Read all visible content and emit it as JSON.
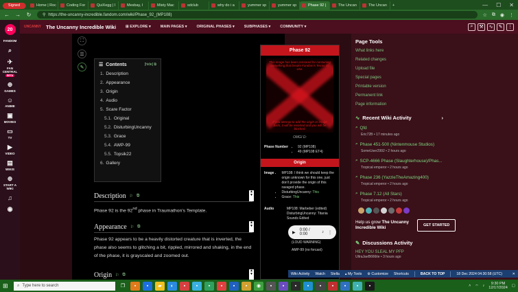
{
  "browser": {
    "tabs": [
      {
        "label": "Home | Roc"
      },
      {
        "label": "Coding For"
      },
      {
        "label": "QuiXegg | I"
      },
      {
        "label": "Mesbay, I"
      },
      {
        "label": "Misty Mac"
      },
      {
        "label": "sdclub"
      },
      {
        "label": "why do i a"
      },
      {
        "label": "yummer sp"
      },
      {
        "label": "yummer sp"
      },
      {
        "label": "Phase 92 |"
      },
      {
        "label": "The Uncan"
      },
      {
        "label": "The Uncan"
      }
    ],
    "signed_in_label": "Signed",
    "url": "https://the-uncanny-incredible.fandom.com/wiki/Phase_92_(MP108)"
  },
  "fandom_rail": {
    "logo_text": "20",
    "items": [
      {
        "label": "FANDOM"
      },
      {
        "label": "FAN CENTRAL"
      },
      {
        "label": "BETA"
      },
      {
        "label": "GAMES"
      },
      {
        "label": "ANIME"
      },
      {
        "label": "MOVIES"
      },
      {
        "label": "TV"
      },
      {
        "label": "VIDEO"
      },
      {
        "label": "WIKIS"
      },
      {
        "label": "START A WIKI"
      }
    ]
  },
  "wiki_header": {
    "logo": "UNCANNY",
    "title": "The Uncanny Incredible Wiki",
    "nav": [
      "EXPLORE",
      "MAIN PAGES",
      "ORIGINAL PHASES",
      "SUBPHASES",
      "COMMUNITY"
    ]
  },
  "toc": {
    "title": "Contents",
    "hide": "hide",
    "items": [
      {
        "num": "1.",
        "label": "Description"
      },
      {
        "num": "2.",
        "label": "Appearance"
      },
      {
        "num": "3.",
        "label": "Origin"
      },
      {
        "num": "4.",
        "label": "Audio"
      },
      {
        "num": "5.",
        "label": "Scare Factor"
      },
      {
        "num": "5.1.",
        "label": "Original"
      },
      {
        "num": "5.2.",
        "label": "DisturbingUncanny"
      },
      {
        "num": "5.3.",
        "label": "Grace"
      },
      {
        "num": "5.4.",
        "label": "AWP-99"
      },
      {
        "num": "5.5.",
        "label": "Topsik22"
      },
      {
        "num": "6.",
        "label": "Gallery"
      }
    ]
  },
  "article": {
    "description_h": "Description",
    "description_pre": "Phase 92 is the 92",
    "description_sup": "nd",
    "description_post": " phase in Traumathon's Template.",
    "appearance_h": "Appearance",
    "appearance_text": "Phase 92 appears to be a heavily distorted creature that is inverted, the phase also seems to glitching a bit, rippled, mirrored and shaking, in the end of the phase, it is grayscaled and zoomed out.",
    "origin_h": "Origin"
  },
  "infobox": {
    "title": "Phase 92",
    "image_caption_top": "This image has been censored for containing something that breaks Fandom's Terms Of Use.",
    "image_caption_bottom": "If you attempt to add the origin or image back, it will be reverted and you will be blocked.",
    "image_caption_below": "OMGI D:",
    "phase_number_k": "Phase Number",
    "phase_number_v1": "92 (MP108)",
    "phase_number_v2": "49 (MP108 ET4)",
    "origin_h": "Origin",
    "image_k": "Image",
    "image_v1": "MP108: I think we should keep the origin unknown for this one, just don't provide the origin of this ravaged phase.",
    "image_v2_pre": "DisturbingUncanny: ",
    "image_v2_link": "This",
    "image_v3_pre": "Grace: ",
    "image_v3_link": "This",
    "audio_k": "Audio",
    "audio_v1": "MP108: Marbeber (edited)",
    "audio_v2": "DisturbingUncanny: Titania Sounds Edited",
    "audio_time": "0:00 / 0:00",
    "audio_note": "(LOUD WARNING)",
    "audio_extra": "AMP-99 (no forcast)"
  },
  "sidebar": {
    "page_tools_h": "Page Tools",
    "page_tools": [
      "What links here",
      "Related changes",
      "Upload file",
      "Special pages",
      "Printable version",
      "Permanent link",
      "Page information"
    ],
    "recent_h": "Recent Wiki Activity",
    "recent": [
      {
        "title": "Qfd",
        "meta": "Eric72B • 17 minutes ago"
      },
      {
        "title": "Phase 451-500 (Nintenmouse Studios)",
        "meta": "SomeUser2992 • 2 hours ago"
      },
      {
        "title": "SCP-4666 Phase (Slaughterhouse)/Phas...",
        "meta": "Tropical emperor • 2 hours ago"
      },
      {
        "title": "Phase 236 (YazzieTheAmazing400)",
        "meta": "Tropical emperor • 2 hours ago"
      },
      {
        "title": "Phase 7.12 (All Stars)",
        "meta": "Tropical emperor • 2 hours ago"
      }
    ],
    "grow_pre": "Help us grow ",
    "grow_bold": "The Uncanny Incredible Wiki",
    "get_started": "GET STARTED",
    "discussions_h": "Discussions Activity",
    "discussions_item": "HEY YOU SLEAL MY PFP",
    "discussions_meta": "UltraJaeB666ite • 3 hours ago"
  },
  "wikibar": {
    "items": [
      "Wiki Activity",
      "Watch",
      "Stella",
      "My Tools",
      "Customize",
      "Shortcuts",
      "BACK TO TOP",
      "18 Dec 2024 04:30:58 (UTC)"
    ]
  },
  "taskbar": {
    "search_placeholder": "Type here to search",
    "time": "9:30 PM",
    "date": "12/17/2024"
  },
  "colors": {
    "accent": "#c4151c",
    "fandom_pink": "#fa005a",
    "link_green": "#7fd87f"
  }
}
